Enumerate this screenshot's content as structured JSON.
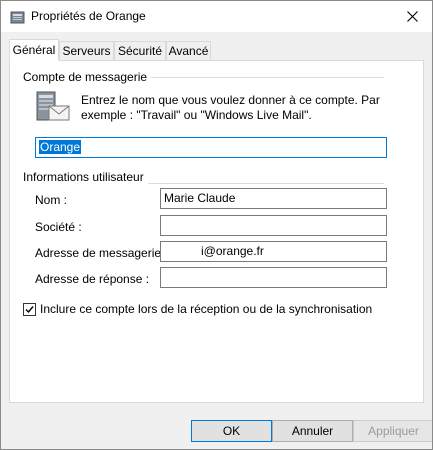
{
  "window": {
    "title": "Propriétés de Orange",
    "icon": "mail-app-icon",
    "close_icon": "close-icon"
  },
  "tabs": [
    {
      "label": "Général",
      "active": true
    },
    {
      "label": "Serveurs",
      "active": false
    },
    {
      "label": "Sécurité",
      "active": false
    },
    {
      "label": "Avancé",
      "active": false
    }
  ],
  "account_group": {
    "title": "Compte de messagerie",
    "description": "Entrez le nom que vous voulez donner à ce compte. Par exemple : \"Travail\" ou \"Windows Live Mail\".",
    "account_name_value": "Orange"
  },
  "user_group": {
    "title": "Informations utilisateur",
    "name_label": "Nom :",
    "name_value": "Marie Claude",
    "company_label": "Société :",
    "company_value": "",
    "email_label": "Adresse de messagerie :",
    "email_value": "i@orange.fr",
    "reply_label": "Adresse de réponse :",
    "reply_value": ""
  },
  "include_checkbox": {
    "label": "Inclure ce compte lors de la réception ou de la synchronisation",
    "checked": true
  },
  "buttons": {
    "ok": "OK",
    "cancel": "Annuler",
    "apply": "Appliquer"
  },
  "colors": {
    "accent": "#0078d7",
    "window_bg": "#f0f0f0",
    "panel_bg": "#ffffff"
  }
}
